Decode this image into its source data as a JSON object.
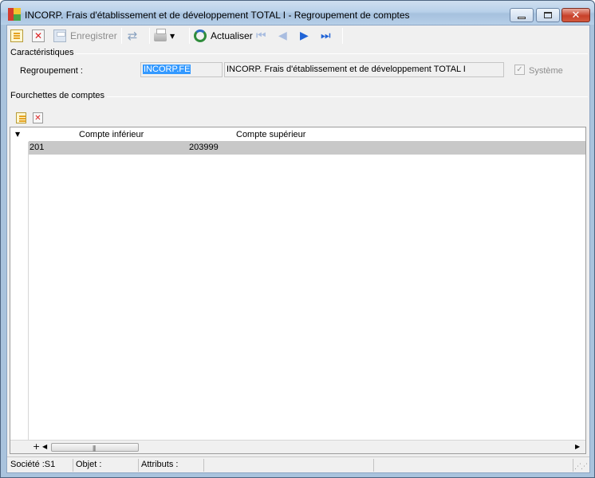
{
  "window": {
    "title": "INCORP. Frais d'établissement et de développement TOTAL I -  Regroupement de comptes"
  },
  "toolbar": {
    "save_label": "Enregistrer",
    "refresh_label": "Actualiser"
  },
  "characteristics": {
    "group_title": "Caractéristiques",
    "regroupement_label": "Regroupement :",
    "code_value": "INCORP.FE",
    "description_value": "INCORP. Frais d'établissement et de développement TOTAL I",
    "system_label": "Système",
    "system_checked": true
  },
  "ranges": {
    "group_title": "Fourchettes de comptes",
    "columns": [
      "Compte inférieur",
      "Compte supérieur"
    ],
    "rows": [
      {
        "lower": "201",
        "upper": "203999"
      }
    ]
  },
  "statusbar": {
    "societe": "Société :S1",
    "objet": "Objet :",
    "attributs": "Attributs :"
  }
}
